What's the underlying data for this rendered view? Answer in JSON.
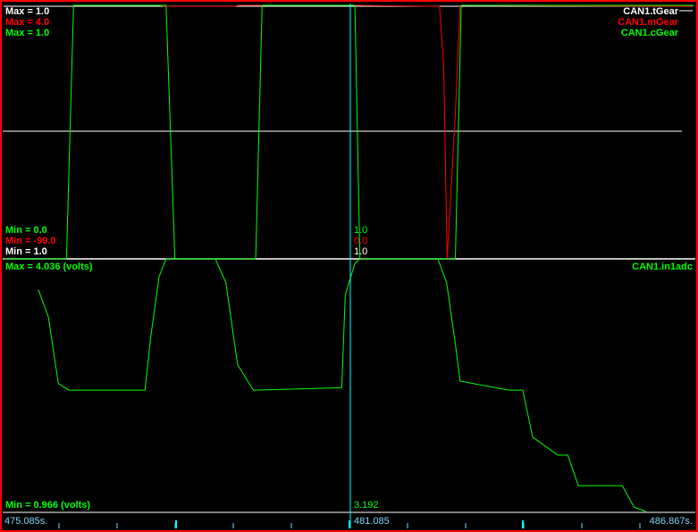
{
  "colors": {
    "background": "#000000",
    "frame": "#ff0000",
    "tGear": "#ffffff",
    "mGear": "#ff0000",
    "cGear": "#00ff00",
    "in1adc": "#00ff00",
    "cursor": "#00ffff",
    "divider": "#ffffff",
    "time_text": "#7fd7ff"
  },
  "top_panel": {
    "max_labels": [
      {
        "text": "Max = 1.0",
        "color": "#ffffff"
      },
      {
        "text": "Max = 4.0",
        "color": "#ff0000"
      },
      {
        "text": "Max = 1.0",
        "color": "#00ff00"
      }
    ],
    "min_labels": [
      {
        "text": "Min = 0.0",
        "color": "#00ff00"
      },
      {
        "text": "Min = -99.0",
        "color": "#ff0000"
      },
      {
        "text": "Min = 1.0",
        "color": "#ffffff"
      }
    ],
    "legend": [
      {
        "text": "CAN1.tGear",
        "color": "#ffffff"
      },
      {
        "text": "CAN1.mGear",
        "color": "#ff0000"
      },
      {
        "text": "CAN1.cGear",
        "color": "#00ff00"
      }
    ],
    "cursor_values": [
      {
        "text": "1.0",
        "color": "#00ff00"
      },
      {
        "text": "0.0",
        "color": "#ff0000"
      },
      {
        "text": "1.0",
        "color": "#ffffff"
      }
    ]
  },
  "bottom_panel": {
    "max_label": "Max = 4.036 (volts)",
    "min_label": "Min = 0.966 (volts)",
    "legend": "CAN1.in1adc",
    "cursor_value": "3.192"
  },
  "time_axis": {
    "start": "475.085s.",
    "cursor": "481.085",
    "end": "486.867s."
  },
  "chart_data": [
    {
      "type": "line",
      "xlim": [
        475.085,
        486.867
      ],
      "series": [
        {
          "name": "CAN1.tGear",
          "color": "#ffffff",
          "ylim": [
            1.0,
            1.0
          ],
          "x": [
            475.085,
            486.867
          ],
          "y": [
            1.0,
            1.0
          ]
        },
        {
          "name": "CAN1.mGear",
          "color": "#ff0000",
          "ylim": [
            -99.0,
            4.0
          ],
          "x": [
            477.74,
            477.86,
            479.02,
            479.1,
            481.085,
            482.5,
            482.53,
            482.6,
            482.66,
            482.8,
            482.88,
            482.9,
            486.867
          ],
          "y": [
            4.0,
            3.6,
            3.6,
            4.0,
            4.0,
            3.6,
            3.6,
            -20.0,
            -99.0,
            -40.0,
            4.0,
            4.0,
            3.6
          ]
        },
        {
          "name": "CAN1.cGear",
          "color": "#00ff00",
          "ylim": [
            0.0,
            1.0
          ],
          "x": [
            475.085,
            476.16,
            476.28,
            477.86,
            478.01,
            479.39,
            479.5,
            481.085,
            481.17,
            482.8,
            482.9,
            486.867
          ],
          "y": [
            0.0,
            0.0,
            1.0,
            1.0,
            0.0,
            0.0,
            1.0,
            1.0,
            0.0,
            0.0,
            1.0,
            1.0
          ]
        }
      ]
    },
    {
      "type": "line",
      "xlim": [
        475.085,
        486.867
      ],
      "series": [
        {
          "name": "CAN1.in1adc",
          "color": "#00ff00",
          "ylim": [
            0.966,
            4.036
          ],
          "x": [
            475.68,
            475.85,
            476.02,
            476.2,
            477.5,
            477.6,
            477.74,
            477.86,
            478.7,
            478.88,
            479.08,
            479.35,
            480.86,
            480.92,
            481.085,
            481.17,
            482.5,
            482.65,
            482.8,
            482.88,
            483.72,
            483.95,
            484.12,
            484.55,
            484.72,
            484.9,
            485.65,
            485.85,
            486.05
          ],
          "y": [
            3.66,
            3.33,
            2.52,
            2.44,
            2.44,
            3.1,
            3.82,
            4.036,
            4.036,
            3.75,
            2.75,
            2.44,
            2.47,
            3.6,
            3.98,
            4.036,
            4.036,
            3.75,
            3.0,
            2.55,
            2.44,
            2.44,
            1.87,
            1.65,
            1.65,
            1.28,
            1.28,
            1.02,
            0.966
          ]
        }
      ]
    }
  ]
}
